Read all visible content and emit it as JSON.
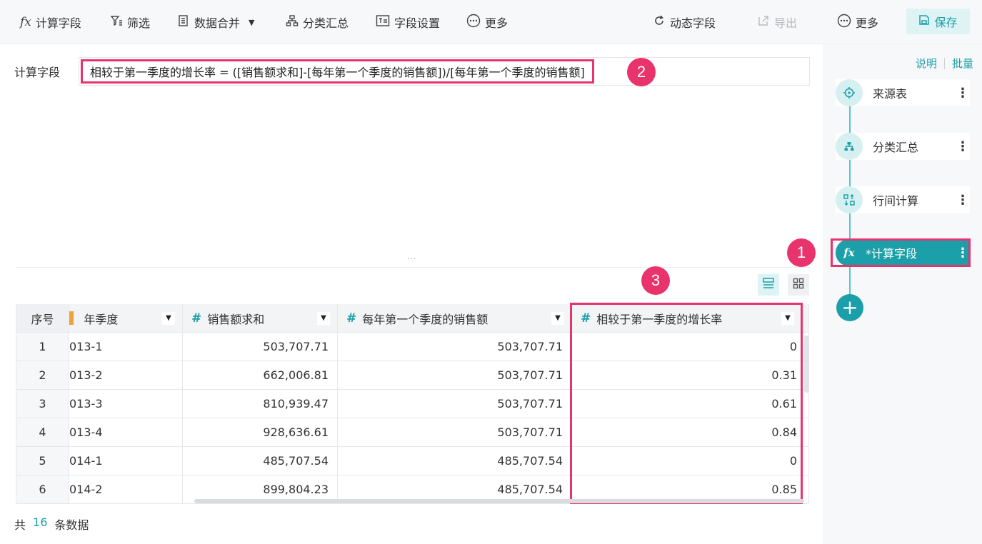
{
  "toolbar": {
    "calc_field": "计算字段",
    "filter": "筛选",
    "merge": "数据合并",
    "group_summary": "分类汇总",
    "field_settings": "字段设置",
    "more_left": "更多",
    "dynamic_field": "动态字段",
    "export": "导出",
    "more_right": "更多",
    "save": "保存"
  },
  "formula": {
    "label": "计算字段",
    "expression": "相较于第一季度的增长率 = ([销售额求和]-[每年第一个季度的销售额])/[每年第一个季度的销售额]"
  },
  "badges": {
    "one": "1",
    "two": "2",
    "three": "3"
  },
  "table": {
    "headers": {
      "index": "序号",
      "quarter": "年季度",
      "sales_sum": "销售额求和",
      "first_quarter_sales": "每年第一个季度的销售额",
      "growth_rate": "相较于第一季度的增长率"
    },
    "rows": [
      {
        "index": "1",
        "quarter": "013-1",
        "sales_sum": "503,707.71",
        "first_quarter_sales": "503,707.71",
        "growth_rate": "0"
      },
      {
        "index": "2",
        "quarter": "013-2",
        "sales_sum": "662,006.81",
        "first_quarter_sales": "503,707.71",
        "growth_rate": "0.31"
      },
      {
        "index": "3",
        "quarter": "013-3",
        "sales_sum": "810,939.47",
        "first_quarter_sales": "503,707.71",
        "growth_rate": "0.61"
      },
      {
        "index": "4",
        "quarter": "013-4",
        "sales_sum": "928,636.61",
        "first_quarter_sales": "503,707.71",
        "growth_rate": "0.84"
      },
      {
        "index": "5",
        "quarter": "014-1",
        "sales_sum": "485,707.54",
        "first_quarter_sales": "485,707.54",
        "growth_rate": "0"
      },
      {
        "index": "6",
        "quarter": "014-2",
        "sales_sum": "899,804.23",
        "first_quarter_sales": "485,707.54",
        "growth_rate": "0.85"
      }
    ]
  },
  "footer": {
    "prefix": "共",
    "count": "16",
    "suffix": "条数据"
  },
  "panel": {
    "help": "说明",
    "batch": "批量",
    "steps": [
      "来源表",
      "分类汇总",
      "行间计算",
      "*计算字段"
    ]
  },
  "colors": {
    "accent": "#1b9fa9",
    "highlight": "#e8336d"
  }
}
